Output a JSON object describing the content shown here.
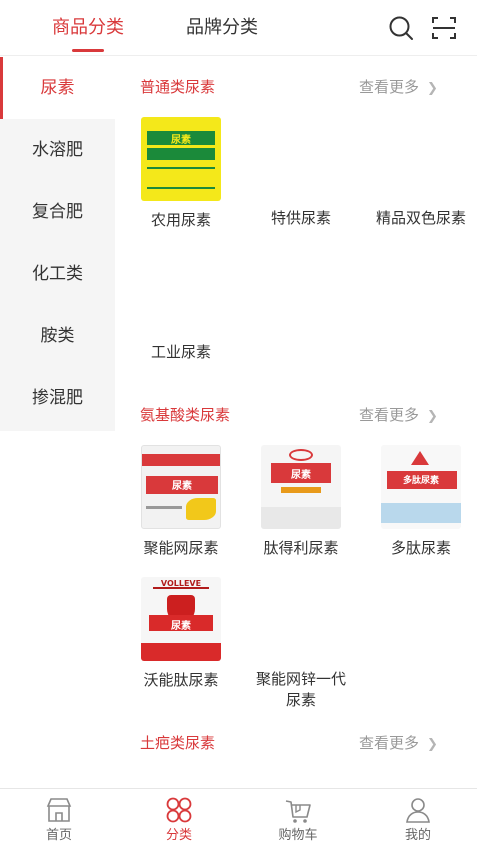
{
  "colors": {
    "accent": "#d9393b",
    "text": "#333333",
    "muted": "#999999",
    "sidebar_bg": "#f5f5f5"
  },
  "header": {
    "tabs": [
      {
        "label": "商品分类",
        "active": true
      },
      {
        "label": "品牌分类",
        "active": false
      }
    ],
    "icons": [
      "search-icon",
      "scan-icon"
    ]
  },
  "sidebar": {
    "items": [
      {
        "label": "尿素",
        "active": true
      },
      {
        "label": "水溶肥",
        "active": false
      },
      {
        "label": "复合肥",
        "active": false
      },
      {
        "label": "化工类",
        "active": false
      },
      {
        "label": "胺类",
        "active": false
      },
      {
        "label": "掺混肥",
        "active": false
      }
    ]
  },
  "sections": [
    {
      "title": "普通类尿素",
      "more": "查看更多",
      "products": [
        {
          "name": "农用尿素",
          "image": "yellow-urea-bag",
          "image_text": "尿素"
        },
        {
          "name": "特供尿素"
        },
        {
          "name": "精品双色尿素"
        },
        {
          "name": "工业尿素"
        }
      ]
    },
    {
      "title": "氨基酸类尿素",
      "more": "查看更多",
      "products": [
        {
          "name": "聚能网尿素",
          "image": "juneng-urea-bag",
          "image_text": "尿素"
        },
        {
          "name": "肽得利尿素",
          "image": "taideli-urea-bag",
          "image_text": "尿素"
        },
        {
          "name": "多肽尿素",
          "image": "duotai-urea-bag",
          "image_text": "多肽尿素"
        },
        {
          "name": "沃能肽尿素",
          "image": "voneng-urea-bag",
          "image_text": "尿素",
          "image_brand": "VOLLEVE"
        },
        {
          "name": "聚能网锌一代尿素"
        }
      ]
    },
    {
      "title": "土疤类尿素",
      "more": "查看更多",
      "products": []
    }
  ],
  "bottom_nav": [
    {
      "label": "首页",
      "icon": "shop-icon",
      "active": false
    },
    {
      "label": "分类",
      "icon": "category-icon",
      "active": true
    },
    {
      "label": "购物车",
      "icon": "cart-icon",
      "active": false
    },
    {
      "label": "我的",
      "icon": "user-icon",
      "active": false
    }
  ]
}
